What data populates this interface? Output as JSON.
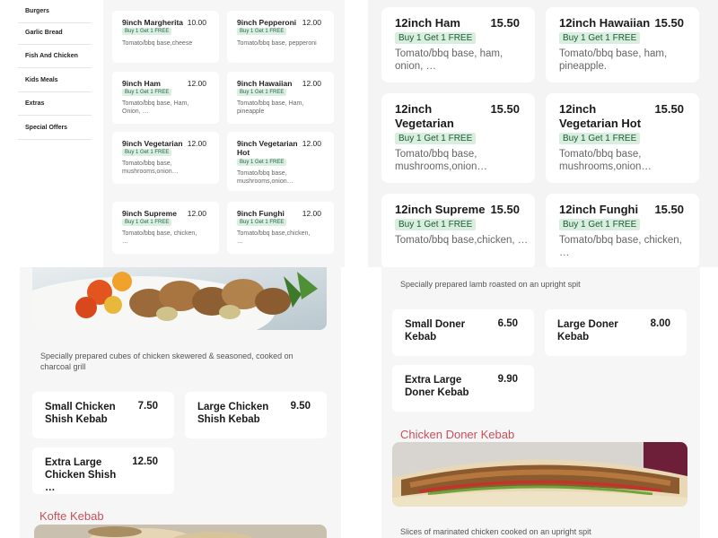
{
  "sidebar": {
    "items": [
      {
        "label": "Burgers"
      },
      {
        "label": "Garlic Bread"
      },
      {
        "label": "Fish And Chicken"
      },
      {
        "label": "Kids Meals"
      },
      {
        "label": "Extras"
      },
      {
        "label": "Special Offers"
      }
    ]
  },
  "pizza_small": [
    {
      "name": "9inch Margherita",
      "price": "10.00",
      "offer": "Buy 1 Get 1 FREE",
      "desc": "Tomato/bbq base,cheese"
    },
    {
      "name": "9inch Pepperoni",
      "price": "12.00",
      "offer": "Buy 1 Get 1 FREE",
      "desc": "Tomato/bbq base, pepperoni"
    },
    {
      "name": "9inch Ham",
      "price": "12.00",
      "offer": "Buy 1 Get 1 FREE",
      "desc": "Tomato/bbq base, Ham, Onion, …"
    },
    {
      "name": "9inch Hawaiian",
      "price": "12.00",
      "offer": "Buy 1 Get 1 FREE",
      "desc": "Tomato/bbq base, Ham, pineapple"
    },
    {
      "name": "9inch Vegetarian",
      "price": "12.00",
      "offer": "Buy 1 Get 1 FREE",
      "desc": "Tomato/bbq base, mushrooms,onion…"
    },
    {
      "name": "9inch Vegetarian Hot",
      "price": "12.00",
      "offer": "Buy 1 Get 1 FREE",
      "desc": "Tomato/bbq base, mushrooms,onion…"
    },
    {
      "name": "9inch Supreme",
      "price": "12.00",
      "offer": "Buy 1 Get 1 FREE",
      "desc": "Tomato/bbq base, chicken, …"
    },
    {
      "name": "9inch Funghi",
      "price": "12.00",
      "offer": "Buy 1 Get 1 FREE",
      "desc": "Tomato/bbq base,chicken, …"
    }
  ],
  "pizza_large": [
    {
      "name": "12inch Ham",
      "price": "15.50",
      "offer": "Buy 1 Get 1 FREE",
      "desc": "Tomato/bbq base, ham, onion, …"
    },
    {
      "name": "12inch Hawaiian",
      "price": "15.50",
      "offer": "Buy 1 Get 1 FREE",
      "desc": "Tomato/bbq base, ham, pineapple."
    },
    {
      "name": "12inch Vegetarian",
      "price": "15.50",
      "offer": "Buy 1 Get 1 FREE",
      "desc": "Tomato/bbq base, mushrooms,onion…"
    },
    {
      "name": "12inch Vegetarian Hot",
      "price": "15.50",
      "offer": "Buy 1 Get 1 FREE",
      "desc": "Tomato/bbq base, mushrooms,onion…"
    },
    {
      "name": "12inch Supreme",
      "price": "15.50",
      "offer": "Buy 1 Get 1 FREE",
      "desc": "Tomato/bbq base,chicken, …"
    },
    {
      "name": "12inch Funghi",
      "price": "15.50",
      "offer": "Buy 1 Get 1 FREE",
      "desc": "Tomato/bbq base, chicken, …"
    }
  ],
  "chicken_shish": {
    "description": "Specially prepared cubes of chicken skewered & seasoned, cooked on charcoal grill",
    "items": [
      {
        "name": "Small Chicken Shish Kebab",
        "price": "7.50"
      },
      {
        "name": "Large Chicken Shish Kebab",
        "price": "9.50"
      },
      {
        "name": "Extra Large Chicken Shish …",
        "price": "12.50"
      }
    ]
  },
  "kofte": {
    "title": "Kofte Kebab"
  },
  "lamb_doner": {
    "description": "Specially prepared lamb roasted on an upright spit",
    "items": [
      {
        "name": "Small Doner Kebab",
        "price": "6.50"
      },
      {
        "name": "Large Doner Kebab",
        "price": "8.00"
      },
      {
        "name": "Extra Large Doner Kebab",
        "price": "9.90"
      }
    ]
  },
  "chicken_doner": {
    "title": "Chicken Doner Kebab",
    "description": "Slices of marinated chicken cooked on an upright spit"
  },
  "colors": {
    "offer_badge_bg": "#dbeee4",
    "offer_badge_text": "#1e6a3c",
    "section_title": "#c94f5a"
  }
}
